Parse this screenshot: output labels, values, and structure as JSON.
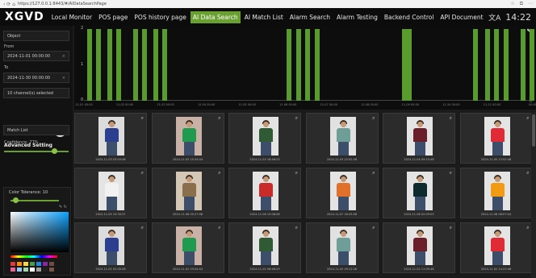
{
  "browser": {
    "url": "https://127.0.0.1:8443/#/AIDataSearchPage",
    "nav_icons": "‹ ⟳ ⌂"
  },
  "app": {
    "logo": "XGVD",
    "clock": "14:22",
    "lang_icon": "translate-icon"
  },
  "nav": [
    {
      "label": "Local Monitor",
      "active": false
    },
    {
      "label": "POS page",
      "active": false
    },
    {
      "label": "POS history page",
      "active": false
    },
    {
      "label": "AI Data Search",
      "active": true
    },
    {
      "label": "AI Match List",
      "active": false
    },
    {
      "label": "Alarm Search",
      "active": false
    },
    {
      "label": "Alarm Testing",
      "active": false
    },
    {
      "label": "Backend Control",
      "active": false
    },
    {
      "label": "API Document",
      "active": false
    }
  ],
  "filters": {
    "object_label": "Object",
    "from_label": "From",
    "from_value": "2024-11-01 00:00:00",
    "to_label": "To",
    "to_value": "2024-11-30 00:00:00",
    "channels": "10 channel(s) selected",
    "advanced": "Advanced Setting",
    "match_list": "Match List",
    "confidence": "Confidence: 77%",
    "confidence_value": 0.77,
    "color_tolerance": "Color Tolerance: 10",
    "color_tolerance_value": 0.1
  },
  "chart_data": {
    "type": "bar",
    "yticks": [
      "2",
      "1",
      "0"
    ],
    "ylim": [
      0,
      2
    ],
    "xticks": [
      "11-01 00:00",
      "11-02 00:00",
      "11-03 00:00",
      "11-04 00:00",
      "11-05 00:00",
      "11-06 00:00",
      "11-07 00:00",
      "11-08 00:00",
      "11-09 00:00",
      "11-10 00:00",
      "11-11 00:00",
      "11-12 00:00"
    ],
    "bars_at_hours": [
      2,
      7,
      14,
      19,
      29,
      34,
      41,
      46,
      119,
      125,
      130,
      136,
      187,
      190,
      229,
      236,
      241,
      247,
      257,
      262
    ],
    "value": 2,
    "color": "#5a9b2e"
  },
  "results": [
    {
      "ts": "2024-11-03 03:04:46",
      "shirt": "#2c3e8f",
      "bg": "#dcdcdc"
    },
    {
      "ts": "2024-11-03 15:34:04",
      "shirt": "#1f9a4e",
      "bg": "#c9b1a8"
    },
    {
      "ts": "2024-11-03 18:46:23",
      "shirt": "#2f5a34",
      "bg": "#e3e3e3"
    },
    {
      "ts": "2024-11-03 22:52:26",
      "shirt": "#6f9e99",
      "bg": "#e1e1e1"
    },
    {
      "ts": "2024-11-04 09:15:48",
      "shirt": "#6b1f2a",
      "bg": "#e4e4e4"
    },
    {
      "ts": "2024-11-05 13:53:48",
      "shirt": "#e02a35",
      "bg": "#e4e4e4"
    },
    {
      "ts": "2024-11-05 15:30:37",
      "shirt": "#f1f1f1",
      "bg": "#e4e4e4"
    },
    {
      "ts": "2024-11-06 00:27:08",
      "shirt": "#8b6e4c",
      "bg": "#d5c7b5"
    },
    {
      "ts": "2024-11-06 15:08:08",
      "shirt": "#c92a2a",
      "bg": "#e4e4e4"
    },
    {
      "ts": "2024-11-07 16:43:58",
      "shirt": "#e0702a",
      "bg": "#e4e4e4"
    },
    {
      "ts": "2024-11-08 02:09:03",
      "shirt": "#0f2a2f",
      "bg": "#e4e4e4"
    },
    {
      "ts": "2024-11-08 08:07:04",
      "shirt": "#f29a14",
      "bg": "#e4e4e4"
    },
    {
      "ts": "2024-11-02 02:00:46",
      "shirt": "#2c3e8f",
      "bg": "#dcdcdc"
    },
    {
      "ts": "2024-11-02 03:04:04",
      "shirt": "#1f9a4e",
      "bg": "#c9b1a8"
    },
    {
      "ts": "2024-11-02 06:46:23",
      "shirt": "#2f5a34",
      "bg": "#e3e3e3"
    },
    {
      "ts": "2024-11-02 09:12:26",
      "shirt": "#6f9e99",
      "bg": "#e1e1e1"
    },
    {
      "ts": "2024-11-02 11:05:48",
      "shirt": "#6b1f2a",
      "bg": "#e4e4e4"
    },
    {
      "ts": "2024-11-02 14:23:48",
      "shirt": "#e02a35",
      "bg": "#e4e4e4"
    }
  ],
  "swatches": [
    "#e53935",
    "#fb8c00",
    "#fdd835",
    "#43a047",
    "#1e88e5",
    "#8e24aa",
    "#6d4c41",
    "#f06292",
    "#90caf9",
    "#a5d6a7",
    "#ffffff",
    "#9e9e9e",
    "#212121",
    "#795548"
  ]
}
